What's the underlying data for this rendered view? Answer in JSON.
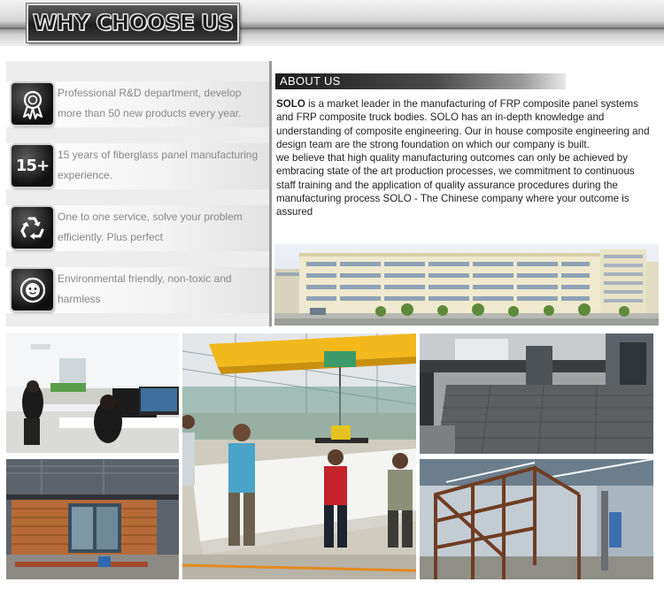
{
  "header": {
    "title": "WHY CHOOSE US"
  },
  "features": [
    {
      "icon": "award-ribbon-icon",
      "text": "Professional R&D department, develop more than 50 new products every year."
    },
    {
      "icon": "badge-15-plus-icon",
      "icon_text": "15+",
      "text": "15 years of fiberglass panel manufacturing experience."
    },
    {
      "icon": "recycle-icon",
      "text": "One to one service, solve your problem efficiently. Plus perfect"
    },
    {
      "icon": "eco-face-icon",
      "text": "Environmental friendly, non-toxic and harmless"
    }
  ],
  "about": {
    "heading": "ABOUT US",
    "brand": "SOLO",
    "paragraph1": " is a market leader in the manufacturing of FRP composite panel systems and FRP composite truck bodies.  SOLO has an in-depth knowledge and understanding of composite engineering. Our in house composite engineering and design team are the strong foundation on which our company is built.",
    "paragraph2": " we believe that high quality manufacturing outcomes can only be achieved by embracing state of the art production processes, we commitment to continuous staff training and the application of quality assurance procedures during the manufacturing process SOLO - The Chinese company where your outcome is assured"
  },
  "colors": {
    "feature_text": "#888888",
    "about_bar_dark": "#1c1c1c",
    "body_text": "#222222"
  }
}
